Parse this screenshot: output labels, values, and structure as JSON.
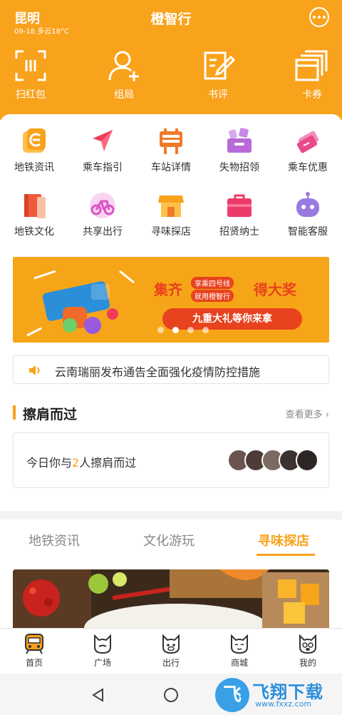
{
  "status": {
    "city": "昆明",
    "weather": "09-18 多云18°C"
  },
  "app": {
    "title": "橙智行"
  },
  "quick_actions": [
    {
      "label": "扫红包",
      "icon": "scan-icon"
    },
    {
      "label": "组局",
      "icon": "add-user-icon"
    },
    {
      "label": "书评",
      "icon": "edit-note-icon"
    },
    {
      "label": "卡券",
      "icon": "card-stack-icon"
    }
  ],
  "services": [
    {
      "label": "地铁资讯",
      "icon": "metro-news-icon",
      "color": "#f9a21b"
    },
    {
      "label": "乘车指引",
      "icon": "navigation-arrow-icon",
      "color": "#ef3c5a"
    },
    {
      "label": "车站详情",
      "icon": "station-sign-icon",
      "color": "#f07a2a"
    },
    {
      "label": "失物招领",
      "icon": "lost-found-basket-icon",
      "color": "#b86ad8"
    },
    {
      "label": "乘车优惠",
      "icon": "ticket-icon",
      "color": "#e94a8c"
    },
    {
      "label": "地铁文化",
      "icon": "culture-book-icon",
      "color": "#f05a3a"
    },
    {
      "label": "共享出行",
      "icon": "bicycle-icon",
      "color": "#d855c6"
    },
    {
      "label": "寻味探店",
      "icon": "shop-icon",
      "color": "#f9a21b"
    },
    {
      "label": "招贤纳士",
      "icon": "briefcase-icon",
      "color": "#ec3a6a"
    },
    {
      "label": "智能客服",
      "icon": "robot-icon",
      "color": "#9a7ae0"
    }
  ],
  "banner": {
    "word1": "集齐",
    "slogan1": "享乘四号线",
    "slogan2": "就用橙智行",
    "word2": "得大奖",
    "cta": "九重大礼等你来拿",
    "active_dot": 2
  },
  "notice": {
    "text": "云南瑞丽发布通告全面强化疫情防控措施"
  },
  "encounter": {
    "title": "擦肩而过",
    "more": "查看更多",
    "text_before": "今日你与",
    "count": "2",
    "text_after": "人擦肩而过"
  },
  "feed_tabs": [
    {
      "label": "地铁资讯",
      "active": false
    },
    {
      "label": "文化游玩",
      "active": false
    },
    {
      "label": "寻味探店",
      "active": true
    }
  ],
  "tabbar": [
    {
      "label": "首页",
      "icon": "train-icon",
      "active": true
    },
    {
      "label": "广场",
      "icon": "mascot-square-icon",
      "active": false
    },
    {
      "label": "出行",
      "icon": "mascot-travel-icon",
      "active": false
    },
    {
      "label": "商城",
      "icon": "mascot-mall-icon",
      "active": false
    },
    {
      "label": "我的",
      "icon": "mascot-me-icon",
      "active": false
    }
  ],
  "watermark": {
    "logo": "飞",
    "text": "飞翔下载",
    "sub": "www.fxxz.com"
  },
  "colors": {
    "brand": "#f9a21b",
    "banner_red": "#e8421e"
  }
}
